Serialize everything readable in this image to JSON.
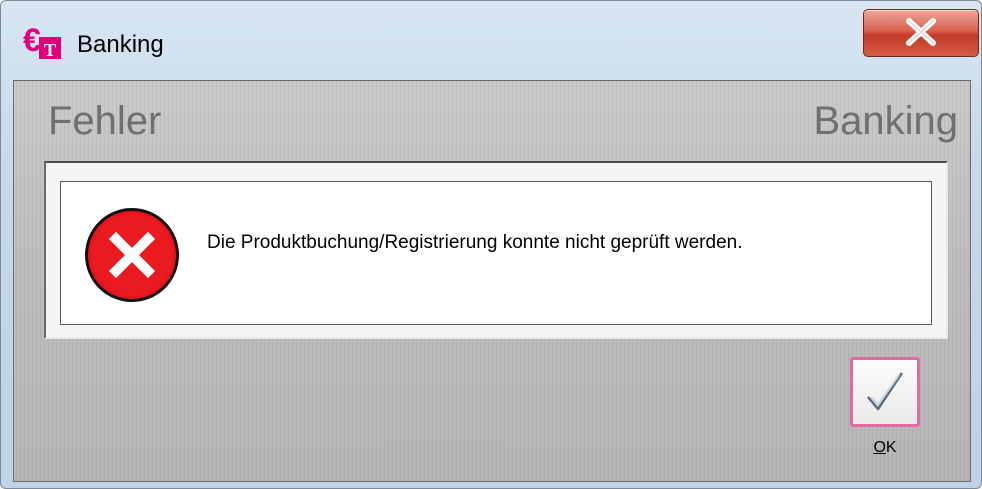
{
  "window": {
    "title": "Banking"
  },
  "dialog": {
    "header_left": "Fehler",
    "header_right": "Banking",
    "message": "Die Produktbuchung/Registrierung konnte nicht geprüft werden.",
    "icon": "error-icon"
  },
  "ok_button": {
    "mnemonic": "O",
    "rest": "K",
    "icon": "checkmark-icon"
  },
  "colors": {
    "close_button": "#c9432e",
    "error_red": "#e8141b",
    "ok_focus_border": "#e46aa4",
    "header_text": "#6f6f6f"
  }
}
